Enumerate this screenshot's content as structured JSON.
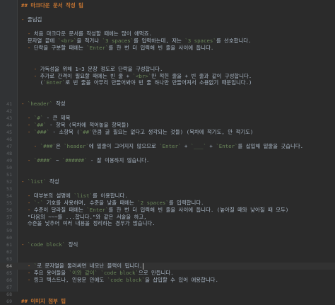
{
  "editor": {
    "current_line": 61,
    "lines": [
      {
        "n": "",
        "parts": [
          {
            "t": "## 마크다운 문서 작성 팁",
            "c": "hdr"
          }
        ]
      },
      {
        "n": "",
        "parts": []
      },
      {
        "n": "",
        "parts": [
          {
            "t": "- ",
            "c": "mk"
          },
          {
            "t": "줄넘김",
            "c": "tx"
          }
        ]
      },
      {
        "n": "",
        "parts": []
      },
      {
        "n": "",
        "parts": [
          {
            "t": "  - ",
            "c": "mk"
          },
          {
            "t": "처음 마크다운 문서를 작성할 때에는 많이 애먹죠.",
            "c": "tx"
          }
        ]
      },
      {
        "n": "",
        "parts": [
          {
            "t": "  문자열 끝에 ",
            "c": "tx"
          },
          {
            "t": "`<br>`",
            "c": "cd"
          },
          {
            "t": "을 적거나 ",
            "c": "tx"
          },
          {
            "t": "`3 spaces`",
            "c": "cd"
          },
          {
            "t": "를 입력하는데, 저는 ",
            "c": "tx"
          },
          {
            "t": "`3 spaces`",
            "c": "cd"
          },
          {
            "t": "를 선호합니다.",
            "c": "tx"
          }
        ]
      },
      {
        "n": "",
        "parts": [
          {
            "t": "  - ",
            "c": "mk"
          },
          {
            "t": "단락을 구분할 때에는 ",
            "c": "tx"
          },
          {
            "t": "`Enter`",
            "c": "cd"
          },
          {
            "t": "를 한 번 더 입력해 빈 줄을 사이에 둡니다.",
            "c": "tx"
          }
        ]
      },
      {
        "n": "",
        "parts": []
      },
      {
        "n": "",
        "parts": []
      },
      {
        "n": "",
        "parts": [
          {
            "t": "    - ",
            "c": "mk"
          },
          {
            "t": "가독성을 위해 1~3 문장 정도로 단락을 구성합니다.",
            "c": "tx"
          }
        ]
      },
      {
        "n": "",
        "parts": [
          {
            "t": "    - ",
            "c": "mk"
          },
          {
            "t": "추가로 간격이 필요할 때에는 빈 줄 + ",
            "c": "tx"
          },
          {
            "t": "`<br>`",
            "c": "cd"
          },
          {
            "t": "만 적힌 줄을 + 빈 줄과 같이 구성합니다.",
            "c": "tx"
          }
        ]
      },
      {
        "n": "",
        "parts": [
          {
            "t": "      (",
            "c": "tx"
          },
          {
            "t": "`Enter`",
            "c": "cd"
          },
          {
            "t": "로 빈 줄을 아무리 만들어봐야 빈 줄 하나만 만들어져서 소용없기 때문입니다.)",
            "c": "tx"
          }
        ]
      },
      {
        "n": "",
        "parts": []
      },
      {
        "n": "",
        "parts": []
      },
      {
        "n": "41",
        "parts": [
          {
            "t": "- ",
            "c": "mk"
          },
          {
            "t": "`header`",
            "c": "cd"
          },
          {
            "t": " 작성",
            "c": "tx"
          }
        ]
      },
      {
        "n": "42",
        "parts": []
      },
      {
        "n": "43",
        "parts": [
          {
            "t": "  - ",
            "c": "mk"
          },
          {
            "t": "`#`",
            "c": "cd"
          },
          {
            "t": " - 큰 제목",
            "c": "tx"
          }
        ]
      },
      {
        "n": "44",
        "parts": [
          {
            "t": "  - ",
            "c": "mk"
          },
          {
            "t": "`##`",
            "c": "cd"
          },
          {
            "t": " - 항목 (목차에 적어놓을 항목들)",
            "c": "tx"
          }
        ]
      },
      {
        "n": "45",
        "parts": [
          {
            "t": "  - ",
            "c": "mk"
          },
          {
            "t": "`###`",
            "c": "cd"
          },
          {
            "t": " - 소항목 (",
            "c": "tx"
          },
          {
            "t": "`##`",
            "c": "cd"
          },
          {
            "t": "만큼 굴 필요는 없다고 생각되는 것들) (목차에 적기도, 안 적기도)",
            "c": "tx"
          }
        ]
      },
      {
        "n": "46",
        "parts": []
      },
      {
        "n": "47",
        "parts": [
          {
            "t": "    - ",
            "c": "mk"
          },
          {
            "t": "`###`",
            "c": "cd"
          },
          {
            "t": "은 ",
            "c": "tx"
          },
          {
            "t": "`header`",
            "c": "cd"
          },
          {
            "t": "에 밑줄이 그어지지 않으므로 ",
            "c": "tx"
          },
          {
            "t": "`Enter`",
            "c": "cd"
          },
          {
            "t": " + ",
            "c": "tx"
          },
          {
            "t": "`___`",
            "c": "cd"
          },
          {
            "t": " + ",
            "c": "tx"
          },
          {
            "t": "`Enter`",
            "c": "cd"
          },
          {
            "t": "를 삽입해 밑줄을 긋습니다.",
            "c": "tx"
          }
        ]
      },
      {
        "n": "48",
        "parts": []
      },
      {
        "n": "49",
        "parts": [
          {
            "t": "  - ",
            "c": "mk"
          },
          {
            "t": "`####`",
            "c": "cd"
          },
          {
            "t": " ~ ",
            "c": "tx"
          },
          {
            "t": "`######`",
            "c": "cd"
          },
          {
            "t": " - 잘 이용하지 않습니다.",
            "c": "tx"
          }
        ]
      },
      {
        "n": "50",
        "parts": []
      },
      {
        "n": "51",
        "parts": []
      },
      {
        "n": "52",
        "parts": [
          {
            "t": "- ",
            "c": "mk"
          },
          {
            "t": "`list`",
            "c": "cd"
          },
          {
            "t": " 작성",
            "c": "tx"
          }
        ]
      },
      {
        "n": "53",
        "parts": []
      },
      {
        "n": "54",
        "parts": [
          {
            "t": "  - ",
            "c": "mk"
          },
          {
            "t": "대부분의 설명에 ",
            "c": "tx"
          },
          {
            "t": "`list`",
            "c": "cd"
          },
          {
            "t": "를 이용합니다.",
            "c": "tx"
          }
        ]
      },
      {
        "n": "55",
        "parts": [
          {
            "t": "  - ",
            "c": "mk"
          },
          {
            "t": "`-`",
            "c": "cd"
          },
          {
            "t": " 기호를 사용하며, 수준을 낮출 때에는 ",
            "c": "tx"
          },
          {
            "t": "`2 spaces`",
            "c": "cd"
          },
          {
            "t": "를 입력합니다.",
            "c": "tx"
          }
        ]
      },
      {
        "n": "56",
        "parts": [
          {
            "t": "  - ",
            "c": "mk"
          },
          {
            "t": "수준이 달라질 때에는 ",
            "c": "tx"
          },
          {
            "t": "`Enter`",
            "c": "cd"
          },
          {
            "t": "를 한 번 더 입력해 빈 줄을 사이에 둡니다. (높아질 때와 낮아질 때 모두)",
            "c": "tx"
          }
        ]
      },
      {
        "n": "57",
        "parts": [
          {
            "t": "  \"다음의 ~~~를 ...합니다.\"와 같은 서술을 하고,",
            "c": "tx"
          }
        ]
      },
      {
        "n": "58",
        "parts": [
          {
            "t": "  수준을 낮추어 여러 내용을 정리하는 경우가 많습니다.",
            "c": "tx"
          }
        ]
      },
      {
        "n": "59",
        "parts": []
      },
      {
        "n": "60",
        "parts": []
      },
      {
        "n": "61",
        "parts": [
          {
            "t": "- ",
            "c": "mk"
          },
          {
            "t": "`code block`",
            "c": "cd"
          },
          {
            "t": " 장식",
            "c": "tx"
          }
        ]
      },
      {
        "n": "62",
        "parts": []
      },
      {
        "n": "63",
        "parts": []
      },
      {
        "n": "64",
        "parts": [
          {
            "t": "  - ",
            "c": "mk"
          },
          {
            "t": "`",
            "c": "cd"
          },
          {
            "t": "로 문자열을 둘러싸면 네모난 블럭이 됩니다.",
            "c": "tx"
          }
        ]
      },
      {
        "n": "65",
        "parts": [
          {
            "t": "  - ",
            "c": "mk"
          },
          {
            "t": "주요 용어들을 ",
            "c": "tx"
          },
          {
            "t": "`이와 같이`",
            "c": "cd"
          },
          {
            "t": " ",
            "c": "tx"
          },
          {
            "t": "`code block`",
            "c": "cd"
          },
          {
            "t": "으로 만듭니다.",
            "c": "tx"
          }
        ]
      },
      {
        "n": "66",
        "parts": [
          {
            "t": "  - ",
            "c": "mk"
          },
          {
            "t": "링크 텍스트나, 인용문 안에도 ",
            "c": "tx"
          },
          {
            "t": "`code block`",
            "c": "cd"
          },
          {
            "t": "을 삽입할 수 있어 애용합니다.",
            "c": "tx"
          }
        ]
      },
      {
        "n": "67",
        "parts": []
      },
      {
        "n": "68",
        "parts": []
      },
      {
        "n": "69",
        "parts": [
          {
            "t": "## 이미지 첨부 팁",
            "c": "hdr"
          }
        ]
      }
    ]
  }
}
